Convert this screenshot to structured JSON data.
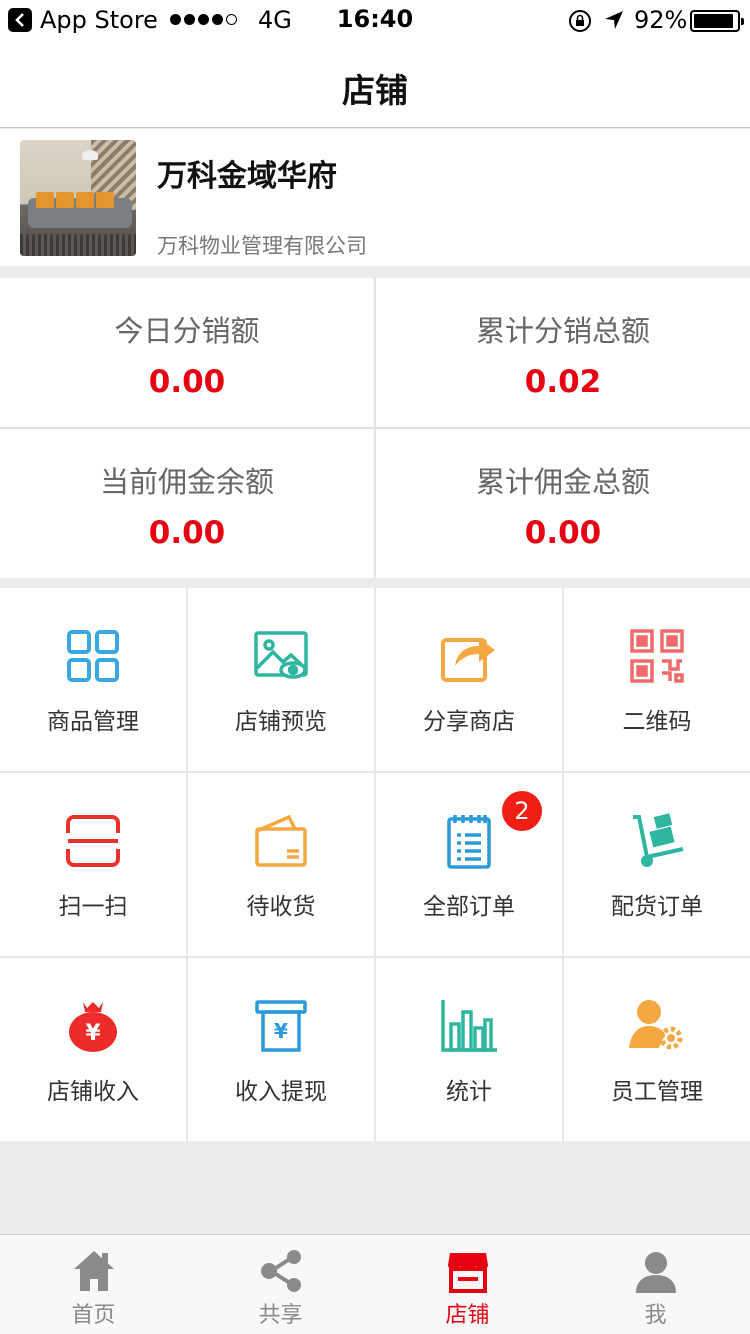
{
  "status_bar": {
    "back_app": "App Store",
    "network": "4G",
    "time": "16:40",
    "battery": "92%",
    "battery_level": 0.92
  },
  "nav": {
    "title": "店铺"
  },
  "store": {
    "name": "万科金域华府",
    "company": "万科物业管理有限公司"
  },
  "stats": [
    {
      "label": "今日分销额",
      "value": "0.00"
    },
    {
      "label": "累计分销总额",
      "value": "0.02"
    },
    {
      "label": "当前佣金余额",
      "value": "0.00"
    },
    {
      "label": "累计佣金总额",
      "value": "0.00"
    }
  ],
  "menu": [
    {
      "label": "商品管理",
      "icon": "grid-icon",
      "color": "#3aa8e0"
    },
    {
      "label": "店铺预览",
      "icon": "image-eye-icon",
      "color": "#2eb6a0"
    },
    {
      "label": "分享商店",
      "icon": "share-icon",
      "color": "#f5a742"
    },
    {
      "label": "二维码",
      "icon": "qrcode-icon",
      "color": "#ef6b6b"
    },
    {
      "label": "扫一扫",
      "icon": "scan-icon",
      "color": "#e8322d"
    },
    {
      "label": "待收货",
      "icon": "wallet-icon",
      "color": "#f5a742"
    },
    {
      "label": "全部订单",
      "icon": "order-list-icon",
      "color": "#2a9ad8",
      "badge": "2"
    },
    {
      "label": "配货订单",
      "icon": "hand-truck-icon",
      "color": "#2eb6a0"
    },
    {
      "label": "店铺收入",
      "icon": "money-bag-icon",
      "color": "#ee2b2b"
    },
    {
      "label": "收入提现",
      "icon": "withdraw-icon",
      "color": "#2a9ad8"
    },
    {
      "label": "统计",
      "icon": "bar-chart-icon",
      "color": "#2eb6a0"
    },
    {
      "label": "员工管理",
      "icon": "staff-gear-icon",
      "color": "#f5a742"
    }
  ],
  "tabs": [
    {
      "label": "首页",
      "icon": "home-icon",
      "active": false
    },
    {
      "label": "共享",
      "icon": "share-nodes-icon",
      "active": false
    },
    {
      "label": "店铺",
      "icon": "shop-icon",
      "active": true
    },
    {
      "label": "我",
      "icon": "user-icon",
      "active": false
    }
  ],
  "colors": {
    "accent_red": "#e60012",
    "tab_inactive": "#8a8a8a"
  }
}
